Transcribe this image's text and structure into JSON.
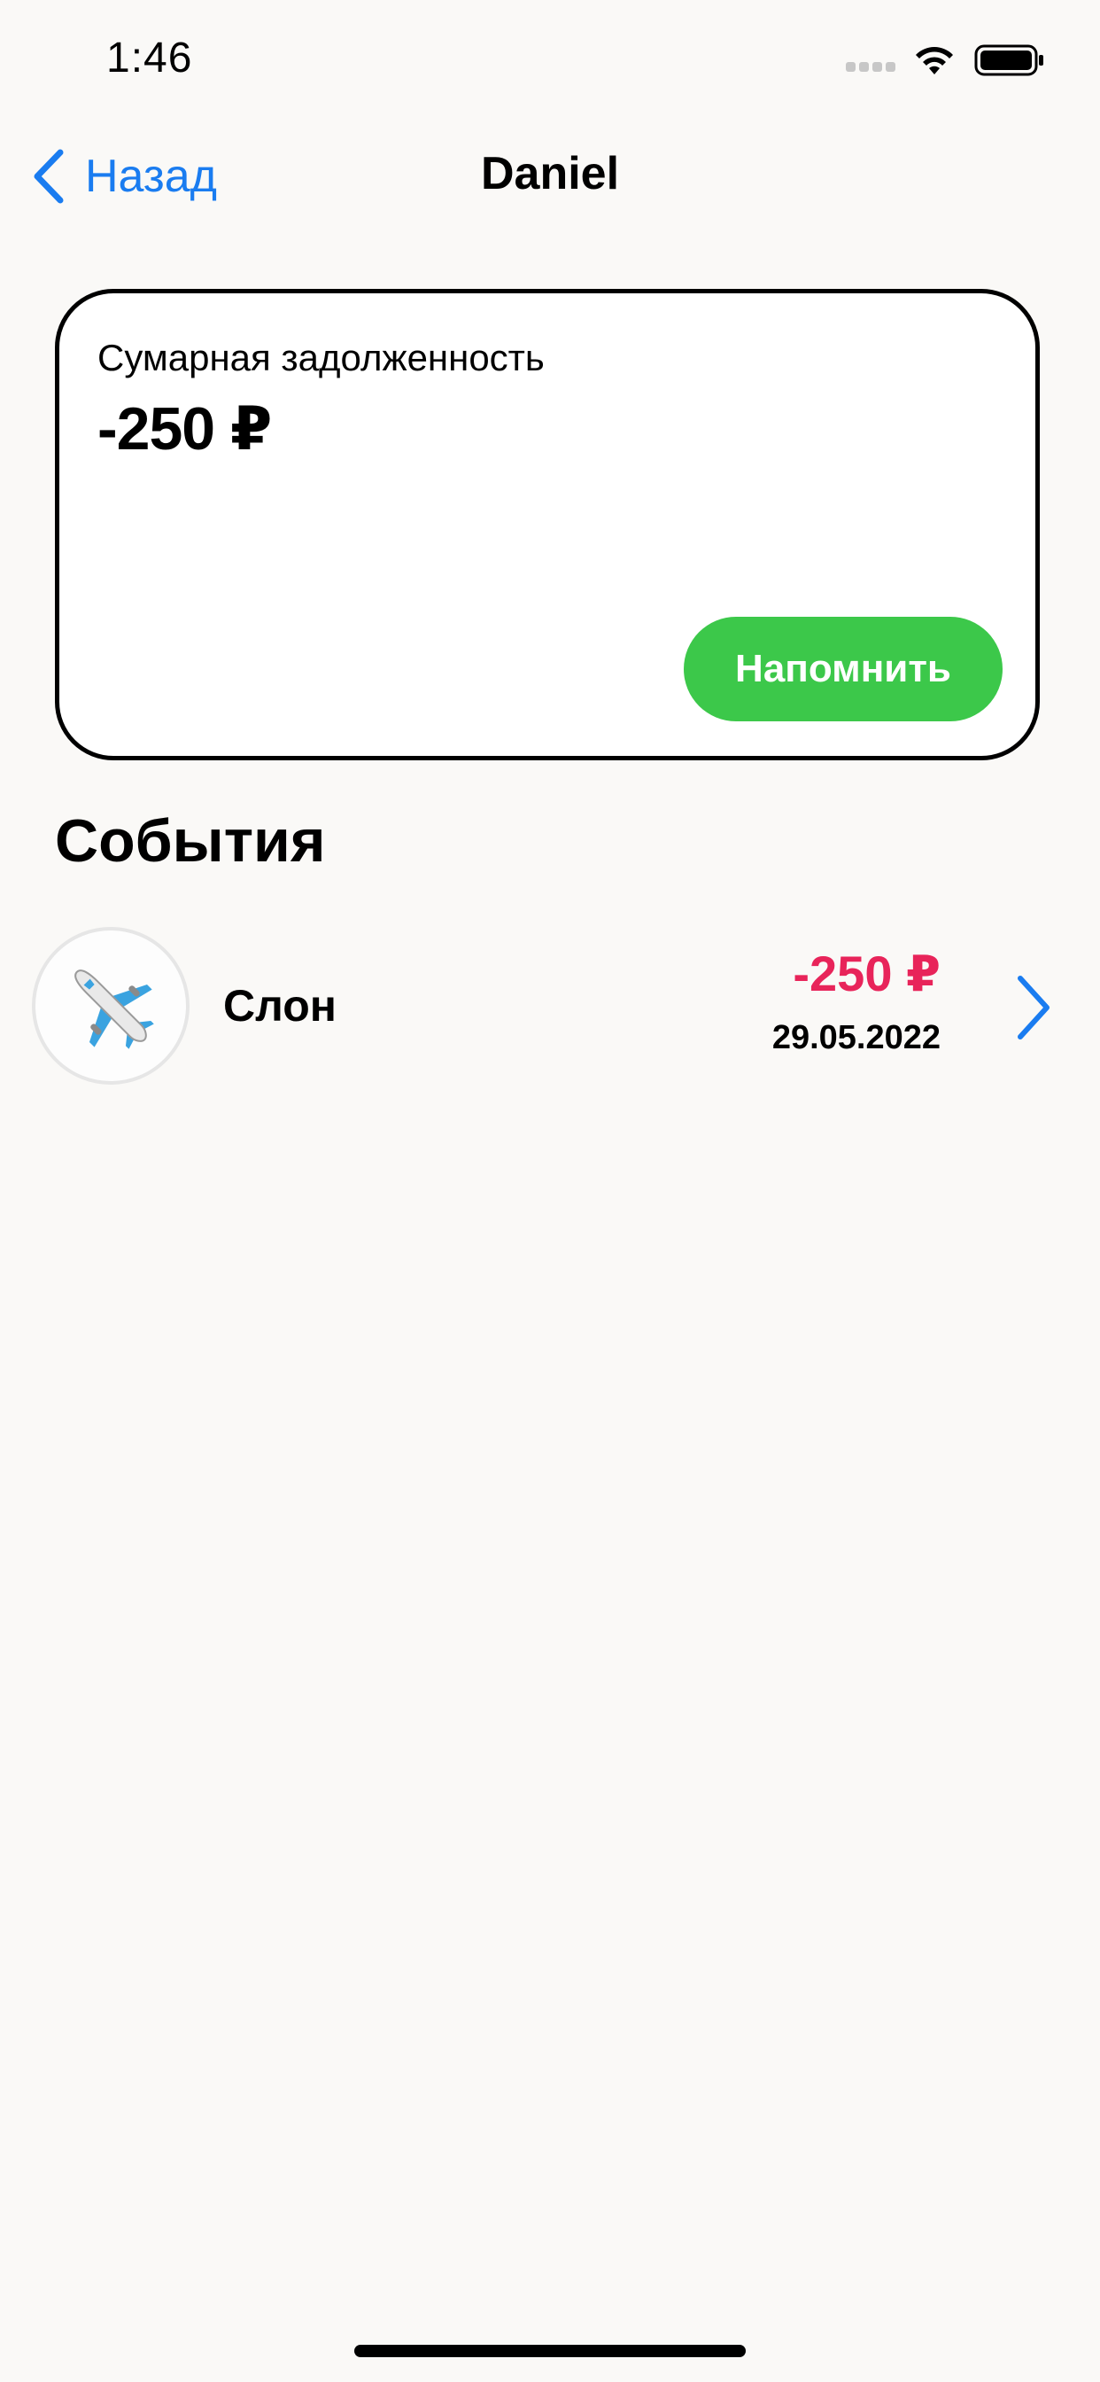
{
  "status_bar": {
    "time": "1:46",
    "icons": [
      "cellular-signal-icon",
      "wifi-icon",
      "battery-icon"
    ]
  },
  "nav": {
    "back_label": "Назад",
    "title": "Daniel",
    "accent_color": "#1a7cf0"
  },
  "debt_card": {
    "label": "Сумарная задолженность",
    "amount": "-250 ₽",
    "remind_button": "Напомнить",
    "button_color": "#3cc84a"
  },
  "events": {
    "heading": "События",
    "items": [
      {
        "icon": "airplane-icon",
        "name": "Слон",
        "amount": "-250 ₽",
        "amount_color": "#e8245a",
        "date": "29.05.2022"
      }
    ]
  }
}
